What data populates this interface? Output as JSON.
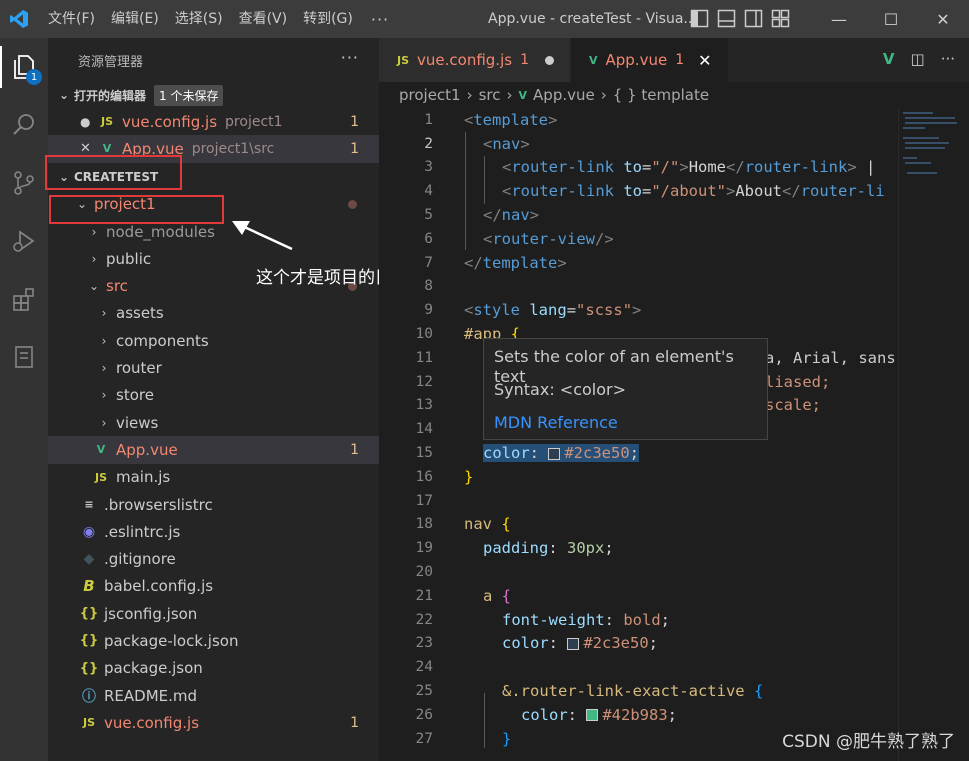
{
  "titlebar": {
    "menu": [
      "文件(F)",
      "编辑(E)",
      "选择(S)",
      "查看(V)",
      "转到(G)"
    ],
    "more": "···",
    "window_title": "App.vue - createTest - Visua...",
    "controls": [
      "—",
      "☐",
      "✕"
    ]
  },
  "activity": {
    "explorer_badge": "1"
  },
  "sidebar": {
    "header": "资源管理器",
    "header_more": "···",
    "open_editors": {
      "label": "打开的编辑器",
      "badge": "1 个未保存"
    },
    "open_files": [
      {
        "name": "vue.config.js",
        "desc": "project1",
        "count": "1",
        "prefix": "●"
      },
      {
        "name": "App.vue",
        "desc": "project1\\src",
        "count": "1",
        "prefix": "✕"
      }
    ],
    "workspace": "CREATETEST",
    "tree": [
      {
        "label": "project1"
      },
      {
        "label": "node_modules"
      },
      {
        "label": "public"
      },
      {
        "label": "src"
      },
      {
        "label": "assets"
      },
      {
        "label": "components"
      },
      {
        "label": "router"
      },
      {
        "label": "store"
      },
      {
        "label": "views"
      },
      {
        "label": "App.vue",
        "count": "1"
      },
      {
        "label": "main.js"
      },
      {
        "label": ".browserslistrc"
      },
      {
        "label": ".eslintrc.js"
      },
      {
        "label": ".gitignore"
      },
      {
        "label": "babel.config.js"
      },
      {
        "label": "jsconfig.json"
      },
      {
        "label": "package-lock.json"
      },
      {
        "label": "package.json"
      },
      {
        "label": "README.md"
      },
      {
        "label": "vue.config.js",
        "count": "1"
      }
    ]
  },
  "annotation": "这个才是项目的目录",
  "tabs": [
    {
      "icon": "JS",
      "name": "vue.config.js",
      "num": "1"
    },
    {
      "icon": "V",
      "name": "App.vue",
      "num": "1"
    }
  ],
  "breadcrumb": [
    "project1",
    "src",
    "App.vue",
    "{ } template"
  ],
  "editor": {
    "line_numbers": [
      "1",
      "2",
      "3",
      "4",
      "5",
      "6",
      "7",
      "8",
      "9",
      "10",
      "11",
      "12",
      "13",
      "14",
      "15",
      "16",
      "17",
      "18",
      "19",
      "20",
      "21",
      "22",
      "23",
      "24",
      "25",
      "26",
      "27"
    ],
    "lines": {
      "l1": {
        "a": "<",
        "b": "template",
        "c": ">"
      },
      "l2": {
        "a": "<",
        "b": "nav",
        "c": ">"
      },
      "l3": {
        "a": "<",
        "b": "router-link",
        "attr": " to",
        "eq": "=",
        "str": "\"/\"",
        "c": ">",
        "text": "Home",
        "d": "</",
        "e": "router-link",
        "f": ">",
        "g": " |"
      },
      "l4": {
        "a": "<",
        "b": "router-link",
        "attr": " to",
        "eq": "=",
        "str": "\"/about\"",
        "c": ">",
        "text": "About",
        "d": "</",
        "e": "router-li"
      },
      "l5": {
        "a": "</",
        "b": "nav",
        "c": ">"
      },
      "l6": {
        "a": "<",
        "b": "router-view",
        "c": "/>"
      },
      "l7": {
        "a": "</",
        "b": "template",
        "c": ">"
      },
      "l9": {
        "a": "<",
        "b": "style",
        "attr": " lang",
        "eq": "=",
        "str": "\"scss\"",
        "c": ">"
      },
      "l10": {
        "sel": "#app",
        "brace": " {"
      },
      "l11": {
        "tail": "a, Arial, sans"
      },
      "l12": {
        "tail": "liased;"
      },
      "l13": {
        "tail": "scale;"
      },
      "l15": {
        "prop": "color",
        "colon": ": ",
        "val": "#2c3e50",
        "semi": ";"
      },
      "l16": {
        "brace": "}"
      },
      "l18": {
        "sel": "nav",
        "brace": " {"
      },
      "l19": {
        "prop": "padding",
        "colon": ": ",
        "val": "30px",
        "semi": ";"
      },
      "l21": {
        "sel": "a",
        "brace": " {"
      },
      "l22": {
        "prop": "font-weight",
        "colon": ": ",
        "val": "bold",
        "semi": ";"
      },
      "l23": {
        "prop": "color",
        "colon": ": ",
        "val": "#2c3e50",
        "semi": ";"
      },
      "l25": {
        "sel": "&.router-link-exact-active",
        "brace": " {"
      },
      "l26": {
        "prop": "color",
        "colon": ": ",
        "val": "#42b983",
        "semi": ";"
      },
      "l27": {
        "brace": "}"
      }
    }
  },
  "tooltip": {
    "line1": "Sets the color of an element's text",
    "line2": "Syntax: <color>",
    "link": "MDN Reference"
  },
  "watermark": "CSDN @肥牛熟了熟了",
  "colors": {
    "swatch1": "#2c3e50",
    "swatch2": "#42b983",
    "accent": "#0e70c0",
    "annotation_red": "#e23a3a"
  }
}
